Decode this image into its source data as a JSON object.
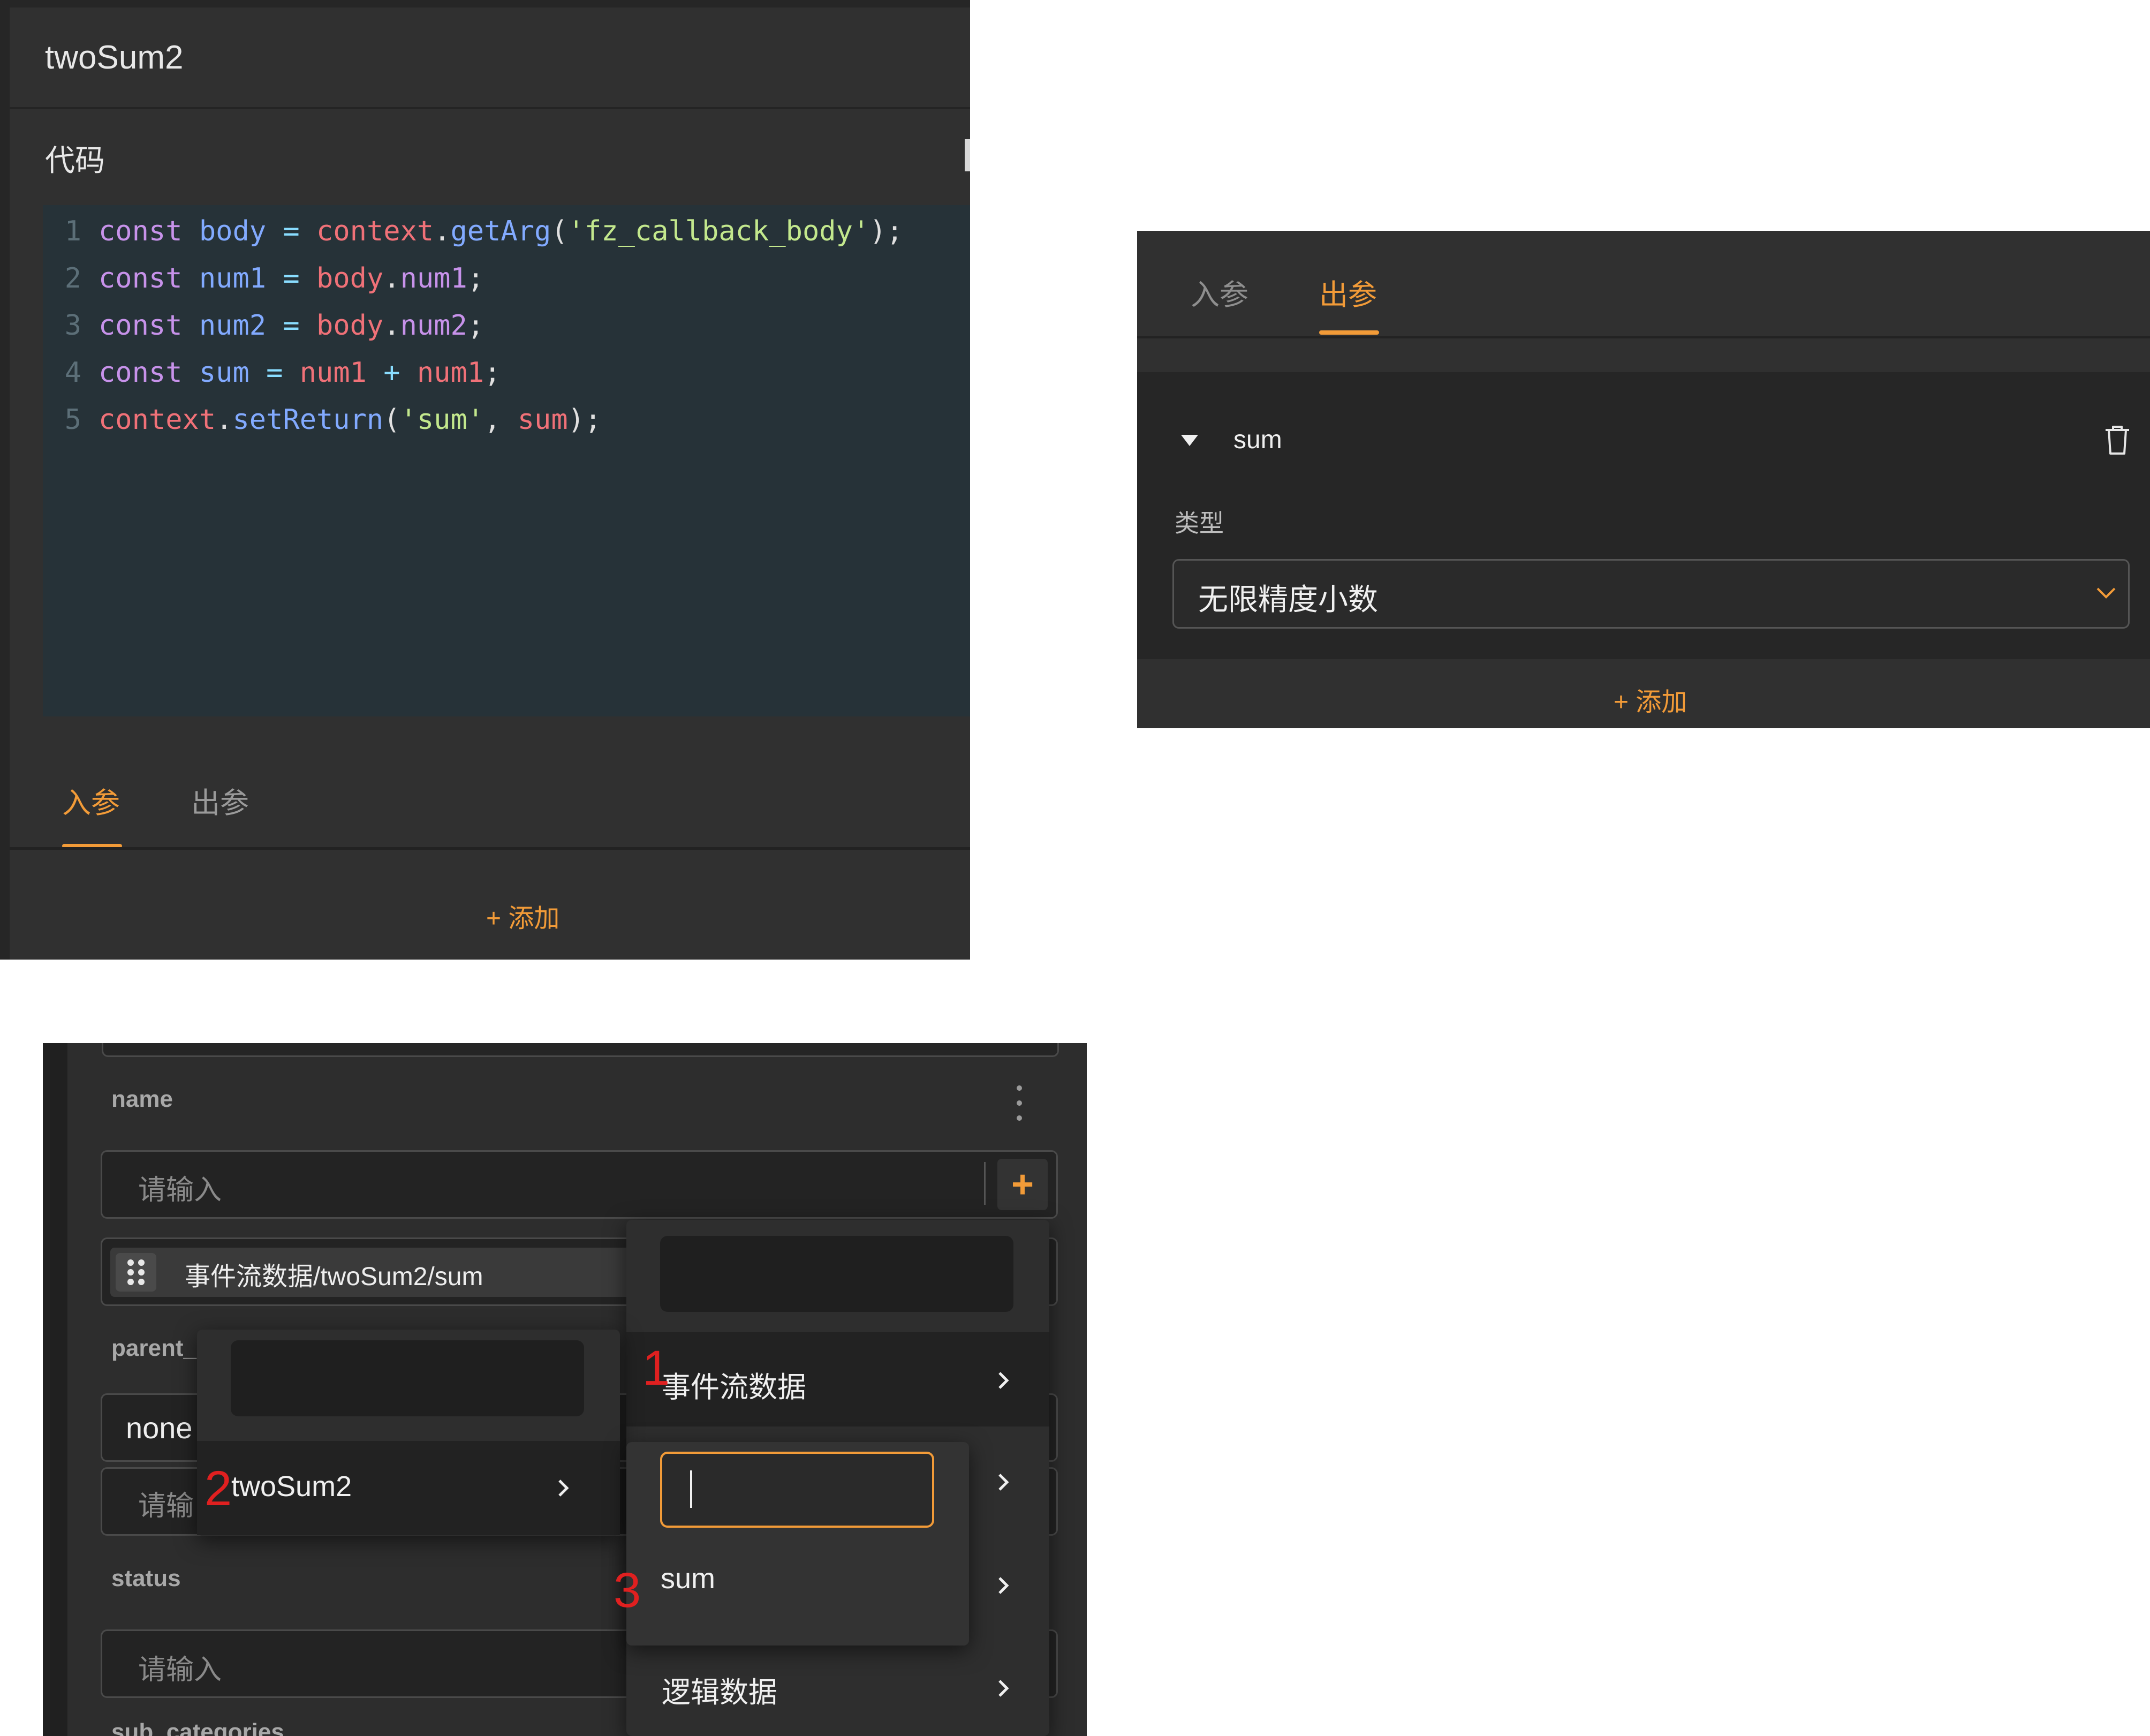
{
  "code_panel": {
    "title": "twoSum2",
    "section_label": "代码",
    "lines": [
      {
        "n": "1",
        "tokens": [
          [
            "kw",
            "const"
          ],
          [
            "pn",
            " "
          ],
          [
            "var",
            "body"
          ],
          [
            "pn",
            " "
          ],
          [
            "op",
            "="
          ],
          [
            "pn",
            " "
          ],
          [
            "obj",
            "context"
          ],
          [
            "pn",
            "."
          ],
          [
            "fn",
            "getArg"
          ],
          [
            "pn",
            "("
          ],
          [
            "str",
            "'fz_callback_body'"
          ],
          [
            "pn",
            ");"
          ]
        ]
      },
      {
        "n": "2",
        "tokens": [
          [
            "kw",
            "const"
          ],
          [
            "pn",
            " "
          ],
          [
            "var",
            "num1"
          ],
          [
            "pn",
            " "
          ],
          [
            "op",
            "="
          ],
          [
            "pn",
            " "
          ],
          [
            "obj",
            "body"
          ],
          [
            "pn",
            "."
          ],
          [
            "kw",
            "num1"
          ],
          [
            "pn",
            ";"
          ]
        ]
      },
      {
        "n": "3",
        "tokens": [
          [
            "kw",
            "const"
          ],
          [
            "pn",
            " "
          ],
          [
            "var",
            "num2"
          ],
          [
            "pn",
            " "
          ],
          [
            "op",
            "="
          ],
          [
            "pn",
            " "
          ],
          [
            "obj",
            "body"
          ],
          [
            "pn",
            "."
          ],
          [
            "kw",
            "num2"
          ],
          [
            "pn",
            ";"
          ]
        ]
      },
      {
        "n": "4",
        "tokens": [
          [
            "kw",
            "const"
          ],
          [
            "pn",
            " "
          ],
          [
            "var",
            "sum"
          ],
          [
            "pn",
            " "
          ],
          [
            "op",
            "="
          ],
          [
            "pn",
            " "
          ],
          [
            "obj",
            "num1"
          ],
          [
            "pn",
            " "
          ],
          [
            "op",
            "+"
          ],
          [
            "pn",
            " "
          ],
          [
            "obj",
            "num1"
          ],
          [
            "pn",
            ";"
          ]
        ]
      },
      {
        "n": "5",
        "tokens": [
          [
            "obj",
            "context"
          ],
          [
            "pn",
            "."
          ],
          [
            "fn",
            "setReturn"
          ],
          [
            "pn",
            "("
          ],
          [
            "str",
            "'sum'"
          ],
          [
            "pn",
            ", "
          ],
          [
            "obj",
            "sum"
          ],
          [
            "pn",
            ");"
          ]
        ]
      }
    ],
    "tabs": {
      "input": "入参",
      "output": "出参"
    },
    "add_label": "+ 添加"
  },
  "output_panel": {
    "tabs": {
      "input": "入参",
      "output": "出参"
    },
    "param_name": "sum",
    "type_label": "类型",
    "type_value": "无限精度小数",
    "add_label": "+ 添加"
  },
  "form_panel": {
    "name_label": "name",
    "name_placeholder": "请输入",
    "plus": "+",
    "token_text": "事件流数据/twoSum2/sum",
    "parent_label": "parent_",
    "parent_value": "none",
    "parent_input_placeholder": "请输",
    "status_label": "status",
    "status_placeholder": "请输入",
    "next_label": "sub_categories",
    "dropdown1": {
      "items": [
        "事件流数据",
        "逻辑数据"
      ]
    },
    "dropdown2": {
      "items": [
        "twoSum2"
      ]
    },
    "dropdown3": {
      "items": [
        "sum"
      ]
    },
    "step_markers": [
      "1",
      "2",
      "3"
    ]
  },
  "colors": {
    "accent": "#f29b38",
    "marker": "#e02020",
    "panel_bg": "#303030",
    "code_bg": "#263238"
  }
}
